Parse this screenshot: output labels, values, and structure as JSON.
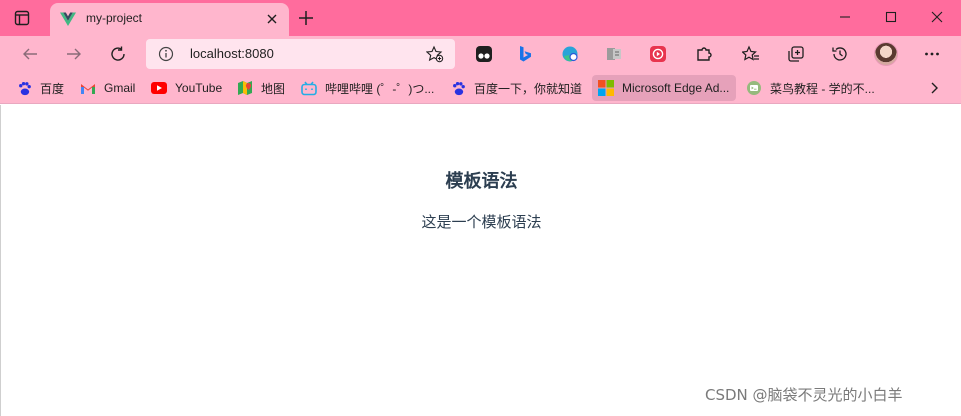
{
  "tab": {
    "title": "my-project"
  },
  "address_bar": {
    "url": "localhost:8080"
  },
  "bookmarks": [
    {
      "label": "百度",
      "icon": "baidu-paw-icon"
    },
    {
      "label": "Gmail",
      "icon": "gmail-icon"
    },
    {
      "label": "YouTube",
      "icon": "youtube-icon"
    },
    {
      "label": "地图",
      "icon": "maps-icon"
    },
    {
      "label": "哔哩哔哩 (゜-゜)つ...",
      "icon": "bilibili-icon"
    },
    {
      "label": "百度一下，你就知道",
      "icon": "baidu-paw-icon"
    },
    {
      "label": "Microsoft Edge Ad...",
      "icon": "microsoft-logo-icon"
    },
    {
      "label": "菜鸟教程 - 学的不...",
      "icon": "runoob-icon"
    }
  ],
  "content": {
    "heading": "模板语法",
    "text": "这是一个模板语法"
  },
  "watermark": "CSDN @脑袋不灵光的小白羊",
  "colors": {
    "tab_strip": "#ff6c9d",
    "toolbar": "#ffb6cd",
    "omnibox": "#ffe4ee",
    "text": "#2c3e50"
  }
}
